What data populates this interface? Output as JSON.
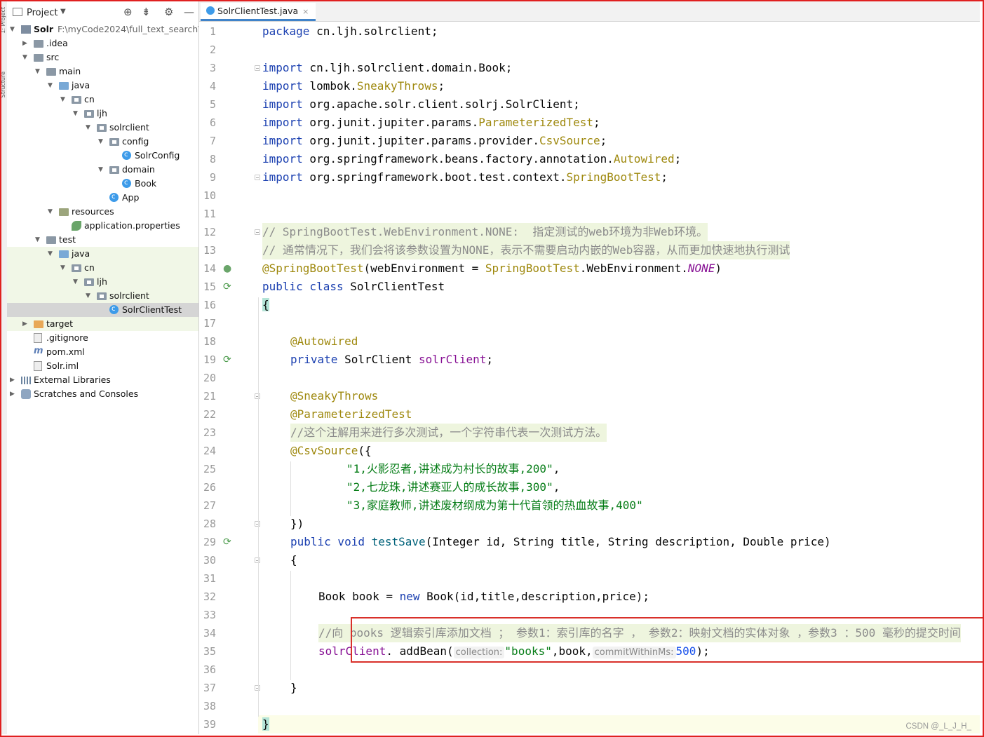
{
  "sidebar": {
    "stripe_labels": [
      "1: Project",
      "Structure"
    ],
    "title": "Project",
    "items": [
      {
        "label": "Solr",
        "path": "F:\\myCode2024\\full_text_search\\Sol"
      },
      {
        "label": ".idea"
      },
      {
        "label": "src"
      },
      {
        "label": "main"
      },
      {
        "label": "java"
      },
      {
        "label": "cn"
      },
      {
        "label": "ljh"
      },
      {
        "label": "solrclient"
      },
      {
        "label": "config"
      },
      {
        "label": "SolrConfig"
      },
      {
        "label": "domain"
      },
      {
        "label": "Book"
      },
      {
        "label": "App"
      },
      {
        "label": "resources"
      },
      {
        "label": "application.properties"
      },
      {
        "label": "test"
      },
      {
        "label": "java"
      },
      {
        "label": "cn"
      },
      {
        "label": "ljh"
      },
      {
        "label": "solrclient"
      },
      {
        "label": "SolrClientTest"
      },
      {
        "label": "target"
      },
      {
        "label": ".gitignore"
      },
      {
        "label": "pom.xml"
      },
      {
        "label": "Solr.iml"
      },
      {
        "label": "External Libraries"
      },
      {
        "label": "Scratches and Consoles"
      }
    ]
  },
  "editor": {
    "tab_label": "SolrClientTest.java",
    "tab_close": "×",
    "line_numbers": [
      "1",
      "2",
      "3",
      "4",
      "5",
      "6",
      "7",
      "8",
      "9",
      "10",
      "11",
      "12",
      "13",
      "14",
      "15",
      "16",
      "17",
      "18",
      "19",
      "20",
      "21",
      "22",
      "23",
      "24",
      "25",
      "26",
      "27",
      "28",
      "29",
      "30",
      "31",
      "32",
      "33",
      "34",
      "35",
      "36",
      "37",
      "38",
      "39"
    ],
    "code": {
      "l1": [
        "package",
        " cn.ljh.solrclient;"
      ],
      "l3": [
        "import",
        " cn.ljh.solrclient.domain.Book;"
      ],
      "l4": [
        "import",
        " lombok.",
        "SneakyThrows",
        ";"
      ],
      "l5": [
        "import",
        " org.apache.solr.client.solrj.SolrClient;"
      ],
      "l6": [
        "import",
        " org.junit.jupiter.params.",
        "ParameterizedTest",
        ";"
      ],
      "l7": [
        "import",
        " org.junit.jupiter.params.provider.",
        "CsvSource",
        ";"
      ],
      "l8": [
        "import",
        " org.springframework.beans.factory.annotation.",
        "Autowired",
        ";"
      ],
      "l9": [
        "import",
        " org.springframework.boot.test.context.",
        "SpringBootTest",
        ";"
      ],
      "l12": "// SpringBootTest.WebEnvironment.NONE:  指定测试的web环境为非Web环境。",
      "l13": "// 通常情况下，我们会将该参数设置为NONE，表示不需要启动内嵌的Web容器，从而更加快速地执行测试",
      "l14": [
        "@SpringBootTest",
        "(webEnvironment = ",
        "SpringBootTest",
        ".WebEnvironment.",
        "NONE",
        ")"
      ],
      "l15": [
        "public class",
        " SolrClientTest"
      ],
      "l16": "{",
      "l18": "@Autowired",
      "l19": [
        "private",
        " SolrClient ",
        "solrClient",
        ";"
      ],
      "l21": "@SneakyThrows",
      "l22": "@ParameterizedTest",
      "l23": "//这个注解用来进行多次测试，一个字符串代表一次测试方法。",
      "l24": [
        "@CsvSource",
        "({"
      ],
      "l25": [
        "\"1,火影忍者,讲述成为村长的故事,200\"",
        ","
      ],
      "l26": [
        "\"2,七龙珠,讲述赛亚人的成长故事,300\"",
        ","
      ],
      "l27": "\"3,家庭教师,讲述废材纲成为第十代首领的热血故事,400\"",
      "l28": "})",
      "l29": [
        "public void",
        " ",
        "testSave",
        "(Integer id, String title, String description, Double price)"
      ],
      "l30": "{",
      "l32": [
        "Book book = ",
        "new",
        " Book(id,title,description,price);"
      ],
      "l34": "//向 books 逻辑索引库添加文档 ； 参数1：索引库的名字 ， 参数2：映射文档的实体对象 ，参数3 ：500 毫秒的提交时间",
      "l35": [
        "solrClient",
        ". addBean(",
        "collection:",
        "\"books\"",
        ",book,",
        "commitWithinMs:",
        "500",
        ");"
      ],
      "l37": "}",
      "l39": "}"
    }
  },
  "watermark": "CSDN @_L_J_H_",
  "colors": {
    "keyword": "#1a3fb0",
    "annotation": "#9e880d",
    "comment": "#8c8c8c",
    "string": "#067d17",
    "number": "#1750eb",
    "field": "#871094",
    "highlight": "#eef5de",
    "selection": "#d5d5d5",
    "red_frame": "#d9302a"
  }
}
